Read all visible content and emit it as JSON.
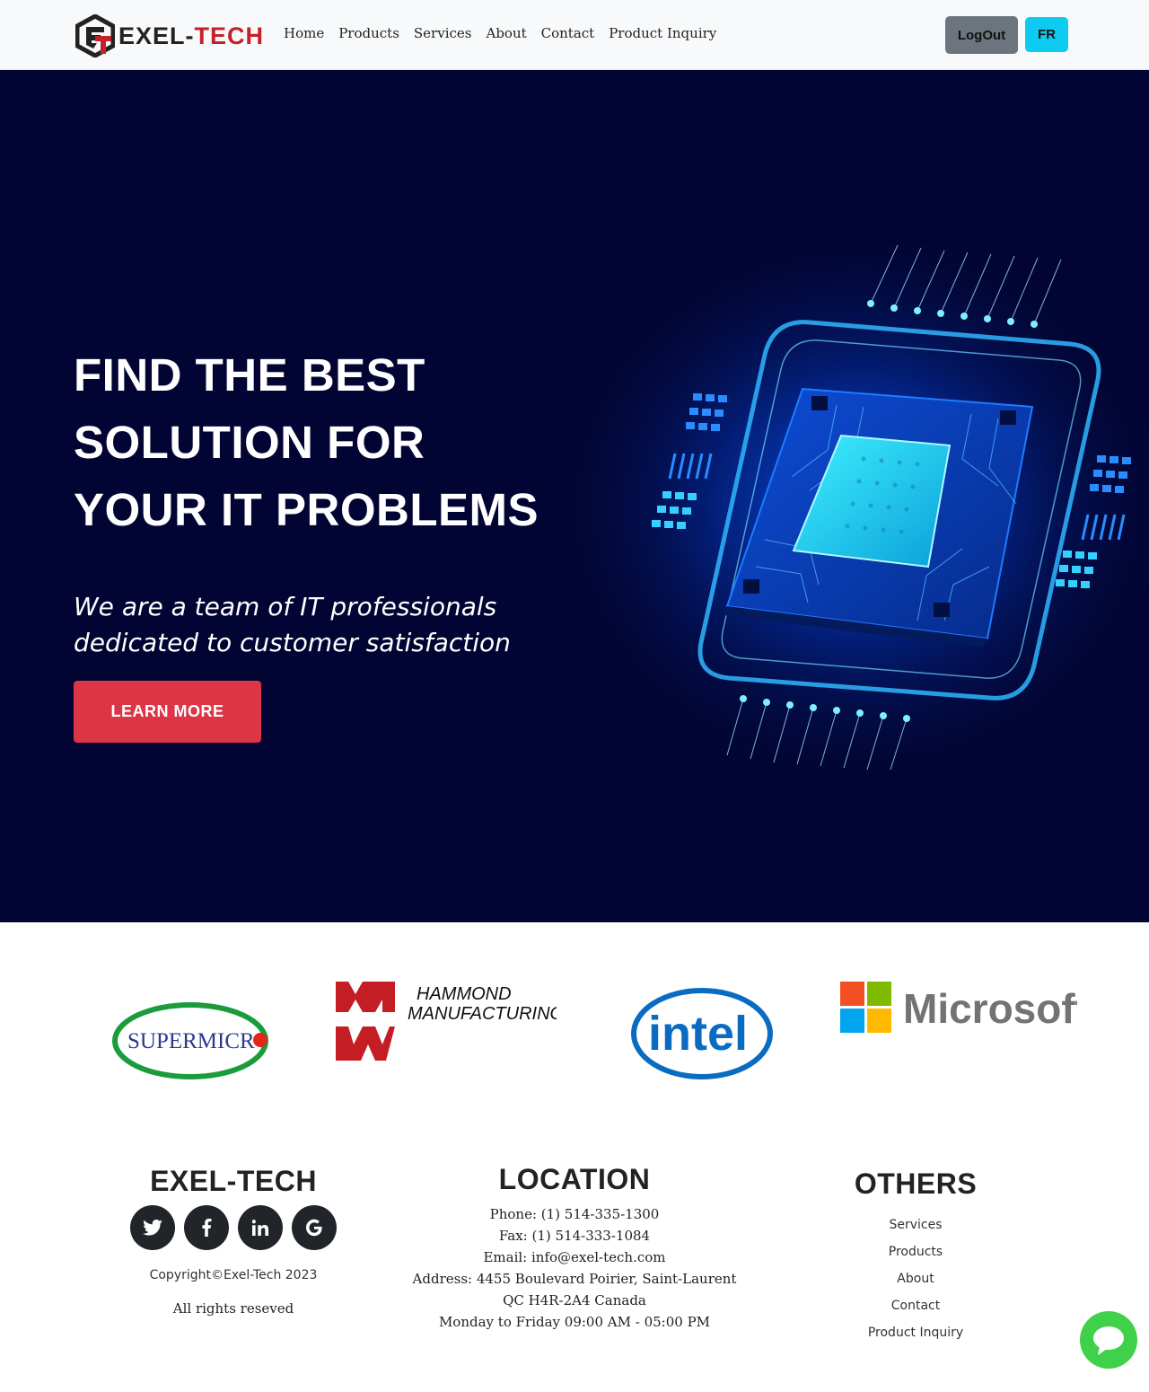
{
  "navbar": {
    "logo_text_main": "EXEL-",
    "logo_text_accent": "TECH",
    "links": [
      "Home",
      "Products",
      "Services",
      "About",
      "Contact",
      "Product Inquiry"
    ],
    "logout_label": "LogOut",
    "lang_label": "FR"
  },
  "hero": {
    "title_line1": "FIND THE BEST",
    "title_line2": "SOLUTION FOR",
    "title_line3": "YOUR IT PROBLEMS",
    "subtitle_line1": "We are a team of IT professionals",
    "subtitle_line2": "dedicated to customer satisfaction",
    "cta_label": "LEARN MORE"
  },
  "partners": {
    "supermicro": "SUPERMICR",
    "hammond_line1": "HAMMOND",
    "hammond_line2": "MANUFACTURING",
    "intel": "intel",
    "microsoft": "Microsoft"
  },
  "footer": {
    "brand": {
      "title": "EXEL-TECH",
      "social_icons": [
        "twitter-icon",
        "facebook-icon",
        "linkedin-icon",
        "google-icon"
      ],
      "copyright": "Copyright©Exel-Tech 2023",
      "rights": "All rights reseved"
    },
    "location": {
      "title": "LOCATION",
      "phone": "Phone: (1) 514-335-1300",
      "fax": "Fax: (1) 514-333-1084",
      "email": "Email: info@exel-tech.com",
      "address1": "Address: 4455 Boulevard Poirier, Saint-Laurent",
      "address2": "QC H4R-2A4 Canada",
      "hours": "Monday to Friday 09:00 AM - 05:00 PM"
    },
    "others": {
      "title": "OTHERS",
      "links": [
        "Services",
        "Products",
        "About",
        "Contact",
        "Product Inquiry"
      ]
    }
  },
  "colors": {
    "hero_bg": "#020533",
    "accent_red": "#dc3545",
    "lang_cyan": "#0dcaf0",
    "chat_green": "#3fd14a"
  }
}
